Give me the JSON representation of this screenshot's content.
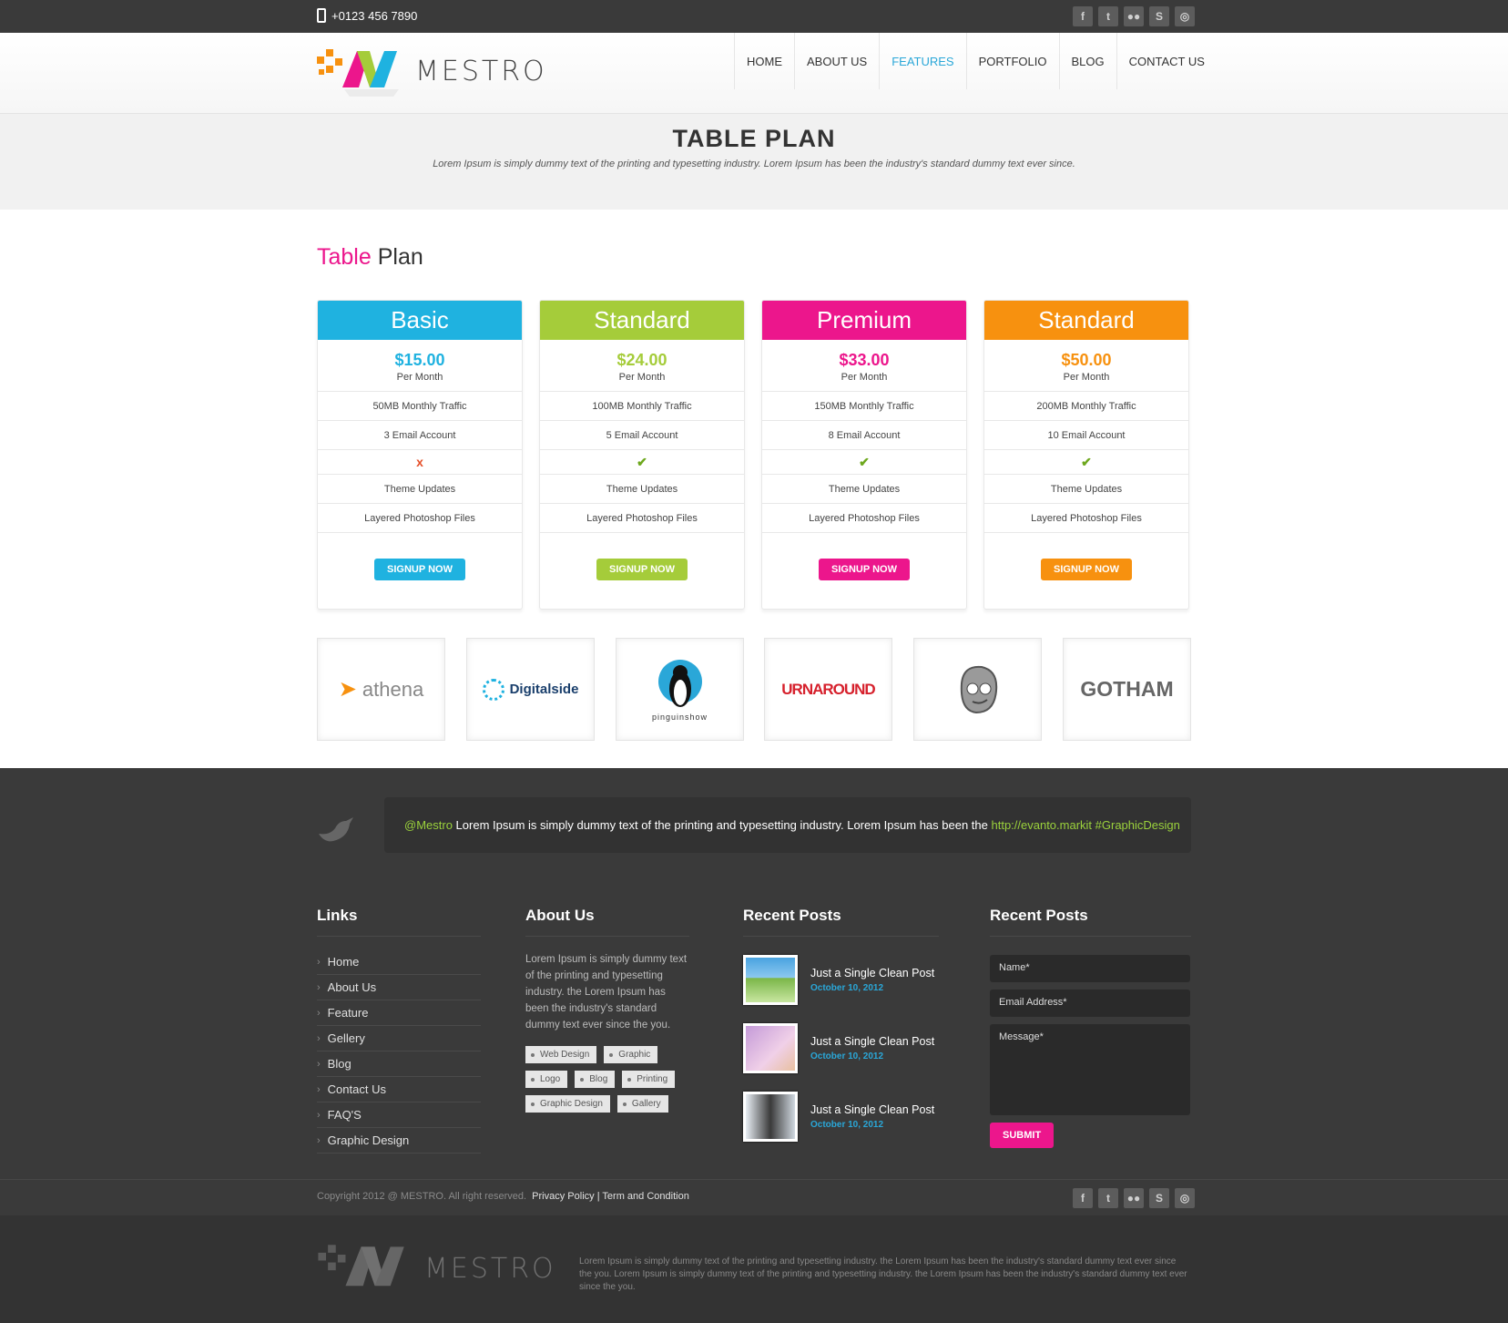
{
  "topbar": {
    "phone": "+0123 456 7890"
  },
  "social": [
    "f",
    "t",
    "fl",
    "s",
    "d"
  ],
  "brand": {
    "name": "MESTRO"
  },
  "nav": [
    {
      "label": "HOME"
    },
    {
      "label": "ABOUT US"
    },
    {
      "label": "FEATURES",
      "active": true
    },
    {
      "label": "PORTFOLIO"
    },
    {
      "label": "BLOG"
    },
    {
      "label": "CONTACT US"
    }
  ],
  "page_title": {
    "title": "TABLE PLAN",
    "subtitle": "Lorem Ipsum is simply dummy text of the printing and typesetting industry. Lorem Ipsum has been the industry's standard dummy text ever since."
  },
  "section": {
    "title_a": "Table",
    "title_b": "Plan"
  },
  "plans": [
    {
      "name": "Basic",
      "color": "#1fb2e0",
      "price": "$15.00",
      "period": "Per Month",
      "traffic": "50MB Monthly Traffic",
      "email": "3 Email Account",
      "feature": "x",
      "updates": "Theme Updates",
      "files": "Layered Photoshop Files",
      "button": "SIGNUP NOW"
    },
    {
      "name": "Standard",
      "color": "#a5cc3a",
      "price": "$24.00",
      "period": "Per Month",
      "traffic": "100MB Monthly Traffic",
      "email": "5 Email Account",
      "feature": "check",
      "updates": "Theme Updates",
      "files": "Layered Photoshop Files",
      "button": "SIGNUP NOW"
    },
    {
      "name": "Premium",
      "color": "#ec168c",
      "price": "$33.00",
      "period": "Per Month",
      "traffic": "150MB Monthly Traffic",
      "email": "8 Email Account",
      "feature": "check",
      "updates": "Theme Updates",
      "files": "Layered Photoshop Files",
      "button": "SIGNUP NOW"
    },
    {
      "name": "Standard",
      "color": "#f7910f",
      "price": "$50.00",
      "period": "Per Month",
      "traffic": "200MB Monthly Traffic",
      "email": "10 Email Account",
      "feature": "check",
      "updates": "Theme Updates",
      "files": "Layered Photoshop Files",
      "button": "SIGNUP NOW"
    }
  ],
  "clients": [
    {
      "name": "athena",
      "icon": "paper-plane-icon"
    },
    {
      "name": "Digitalside",
      "icon": "dots-ring-icon"
    },
    {
      "name": "pinguinshow",
      "icon": "penguin-icon"
    },
    {
      "name": "URNAROUND",
      "icon": "text-logo"
    },
    {
      "name": "",
      "icon": "cartoon-face-icon"
    },
    {
      "name": "GOTHAM",
      "icon": "text-logo"
    }
  ],
  "tweet": {
    "handle": "@Mestro",
    "text": " Lorem Ipsum is simply dummy text of the printing and typesetting industry. Lorem Ipsum has been the ",
    "link": "http://evanto.markit #GraphicDesign"
  },
  "footer": {
    "links_title": "Links",
    "links": [
      "Home",
      "About Us",
      "Feature",
      "Gellery",
      "Blog",
      "Contact Us",
      "FAQ'S",
      "Graphic Design"
    ],
    "about_title": "About Us",
    "about_text": "Lorem Ipsum is simply dummy text of the printing and typesetting industry. the Lorem Ipsum has been the industry's standard dummy text ever since the you.",
    "tags": [
      "Web Design",
      "Graphic",
      "Logo",
      "Blog",
      "Printing",
      "Graphic Design",
      "Gallery"
    ],
    "posts_title": "Recent Posts",
    "posts": [
      {
        "title": "Just a Single Clean Post",
        "date": "October 10, 2012"
      },
      {
        "title": "Just a Single Clean Post",
        "date": "October 10, 2012"
      },
      {
        "title": "Just a Single Clean Post",
        "date": "October 10, 2012"
      }
    ],
    "form_title": "Recent Posts",
    "form": {
      "name": "Name*",
      "email": "Email Address*",
      "message": "Message*",
      "submit": "SUBMIT"
    }
  },
  "copyright": {
    "text": "Copyright 2012 @ MESTRO. All right reserved.",
    "privacy": "Privacy Policy",
    "sep": "|",
    "terms": "Term and Condition"
  },
  "bottom": {
    "text": "Lorem Ipsum is simply dummy text of the printing and typesetting industry. the Lorem Ipsum has been the industry's standard dummy text ever since the you. Lorem Ipsum is simply dummy text of the printing and typesetting industry. the Lorem Ipsum has been the industry's standard dummy text ever since the you."
  }
}
